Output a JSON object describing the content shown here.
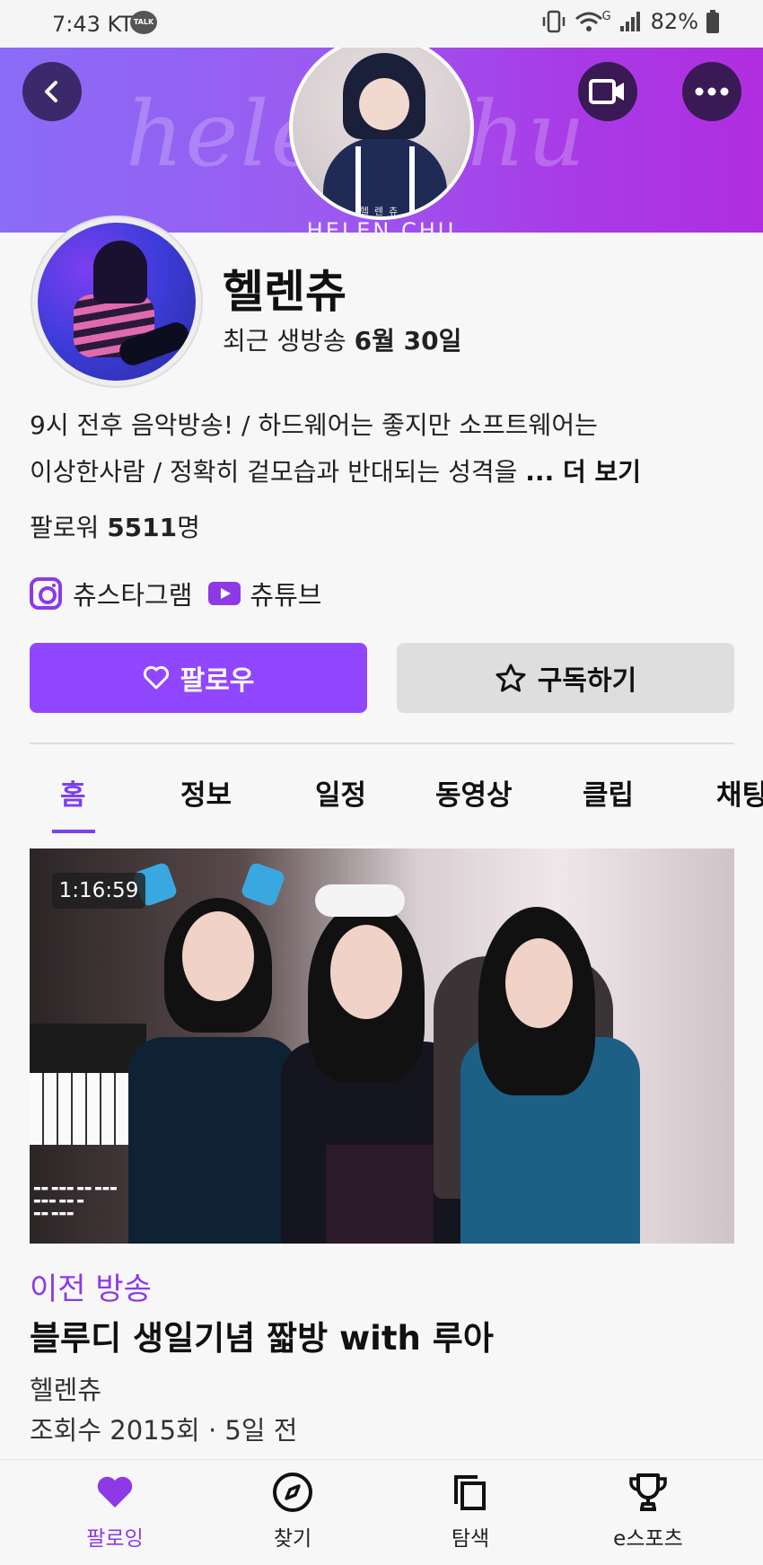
{
  "status_bar": {
    "time": "7:43 KT",
    "talk_badge": "TALK",
    "network": "G",
    "battery": "82%"
  },
  "banner": {
    "script_text": "helen chu",
    "sub_text": "헬렌츄",
    "name_text": "HELEN CHU",
    "back_icon": "chevron-left-icon",
    "video_icon": "video-camera-icon",
    "more_icon": "more-dots-icon"
  },
  "profile": {
    "name": "헬렌츄",
    "last_live_prefix": "최근 생방송",
    "last_live_date": "6월 30일",
    "bio_line1": "9시 전후 음악방송! / 하드웨어는 좋지만 소프트웨어는",
    "bio_line2": "이상한사람 / 정확히 겉모습과 반대되는 성격을",
    "bio_more": "... 더 보기",
    "followers_label": "팔로워",
    "followers_count": "5511",
    "followers_unit": "명"
  },
  "socials": [
    {
      "label": "츄스타그램",
      "icon": "instagram-icon"
    },
    {
      "label": "츄튜브",
      "icon": "youtube-icon"
    }
  ],
  "actions": {
    "follow_label": "팔로우",
    "subscribe_label": "구독하기"
  },
  "tabs": [
    {
      "label": "홈",
      "active": true
    },
    {
      "label": "정보"
    },
    {
      "label": "일정"
    },
    {
      "label": "동영상"
    },
    {
      "label": "클립"
    },
    {
      "label": "채팅"
    }
  ],
  "video": {
    "duration": "1:16:59",
    "label": "이전 방송",
    "title": "블루디 생일기념 짧방 with 루아",
    "channel": "헬렌츄",
    "meta": "조회수 2015회 · 5일 전"
  },
  "bottom_nav": [
    {
      "label": "팔로잉",
      "icon": "heart-icon",
      "active": true
    },
    {
      "label": "찾기",
      "icon": "compass-icon"
    },
    {
      "label": "탐색",
      "icon": "browse-icon"
    },
    {
      "label": "e스포츠",
      "icon": "trophy-icon"
    }
  ],
  "colors": {
    "accent": "#9146ff",
    "accent_text": "#8d3ae6",
    "banner_start": "#8a6cf7",
    "banner_end": "#b02ee0"
  }
}
